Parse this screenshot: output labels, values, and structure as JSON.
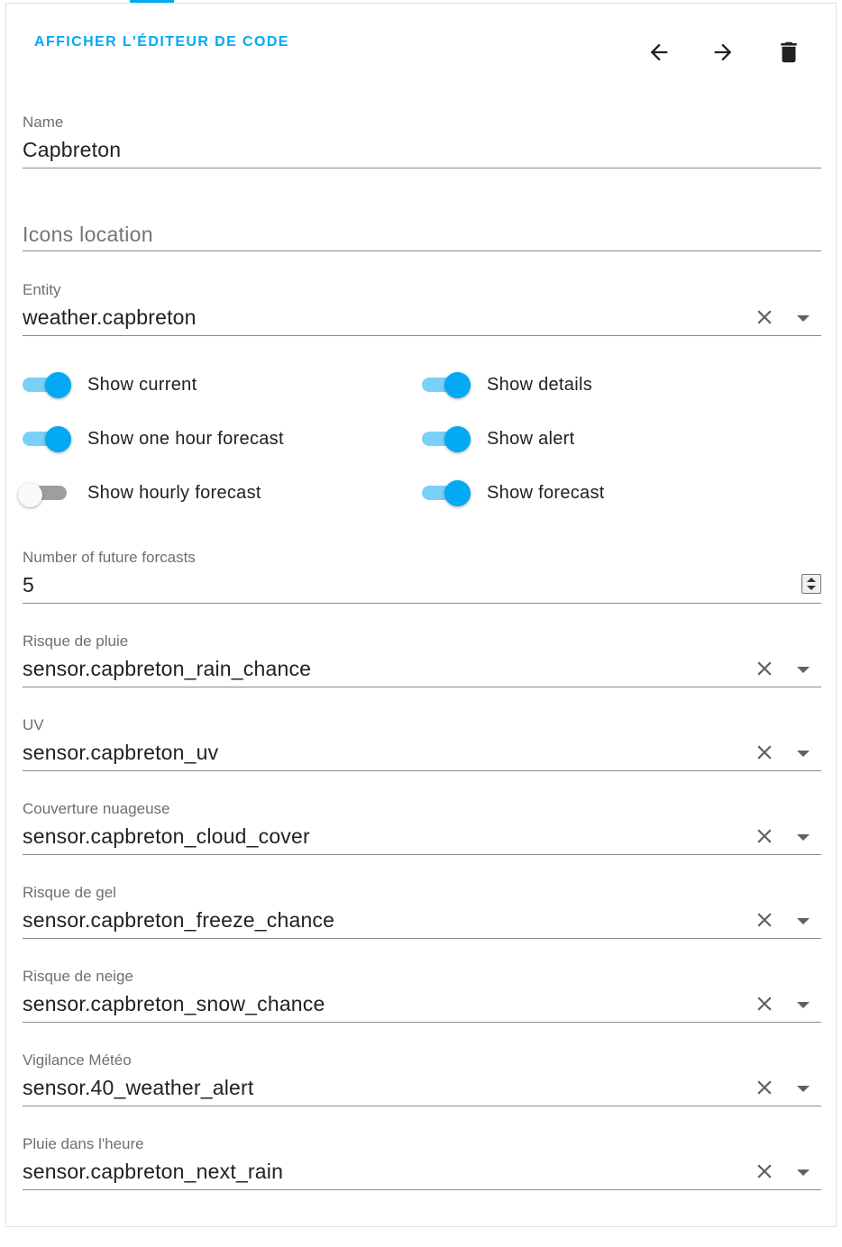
{
  "header": {
    "code_editor_label": "AFFICHER L'ÉDITEUR DE CODE",
    "icons": [
      "arrow-left-icon",
      "arrow-right-icon",
      "delete-icon"
    ]
  },
  "fields": {
    "name": {
      "label": "Name",
      "value": "Capbreton"
    },
    "icons_location": {
      "placeholder": "Icons location"
    },
    "entity": {
      "label": "Entity",
      "value": "weather.capbreton"
    }
  },
  "toggles": {
    "show_current": {
      "label": "Show current",
      "on": true
    },
    "show_details": {
      "label": "Show details",
      "on": true
    },
    "show_one_hour_forecast": {
      "label": "Show one hour forecast",
      "on": true
    },
    "show_alert": {
      "label": "Show alert",
      "on": true
    },
    "show_hourly_forecast": {
      "label": "Show hourly forecast",
      "on": false
    },
    "show_forecast": {
      "label": "Show forecast",
      "on": true
    }
  },
  "future_forecasts": {
    "label": "Number of future forcasts",
    "value": "5"
  },
  "sensors": [
    {
      "label": "Risque de pluie",
      "value": "sensor.capbreton_rain_chance"
    },
    {
      "label": "UV",
      "value": "sensor.capbreton_uv"
    },
    {
      "label": "Couverture nuageuse",
      "value": "sensor.capbreton_cloud_cover"
    },
    {
      "label": "Risque de gel",
      "value": "sensor.capbreton_freeze_chance"
    },
    {
      "label": "Risque de neige",
      "value": "sensor.capbreton_snow_chance"
    },
    {
      "label": "Vigilance Météo",
      "value": "sensor.40_weather_alert"
    },
    {
      "label": "Pluie dans l'heure",
      "value": "sensor.capbreton_next_rain"
    }
  ],
  "colors": {
    "accent": "#03a9f4",
    "accent_light": "#7ad0f7",
    "text": "#212121",
    "label": "#6f6f6f"
  }
}
